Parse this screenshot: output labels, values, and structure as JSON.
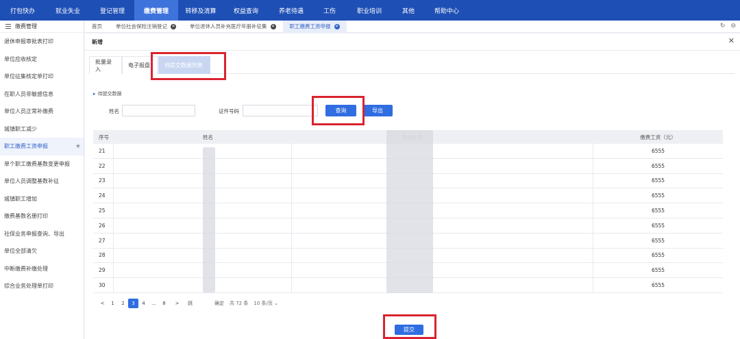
{
  "nav": {
    "items": [
      {
        "label": "打包快办"
      },
      {
        "label": "就业失业"
      },
      {
        "label": "登记管理"
      },
      {
        "label": "缴费管理",
        "active": true
      },
      {
        "label": "转移及清算"
      },
      {
        "label": "权益查询"
      },
      {
        "label": "养老待遇"
      },
      {
        "label": "工伤"
      },
      {
        "label": "职业培训"
      },
      {
        "label": "其他"
      },
      {
        "label": "帮助中心"
      }
    ]
  },
  "sidebar": {
    "title": "缴费管理",
    "items": [
      {
        "label": "退休申报审批表打印"
      },
      {
        "label": "单位应收核定"
      },
      {
        "label": "单位征集核定单打印"
      },
      {
        "label": "在职人员非敏感信息"
      },
      {
        "label": "单位人员正常补缴费"
      },
      {
        "label": "城镇职工减少"
      },
      {
        "label": "职工缴费工资申报",
        "active": true
      },
      {
        "label": "单个职工缴费基数变更申报"
      },
      {
        "label": "单位人员调整基数补征"
      },
      {
        "label": "城镇职工增加"
      },
      {
        "label": "缴费基数名册打印"
      },
      {
        "label": "社保业务申报查询、导出"
      },
      {
        "label": "单位全部清欠"
      },
      {
        "label": "中断缴费补缴处理"
      },
      {
        "label": "综合业务处理单打印"
      }
    ]
  },
  "tabs": {
    "items": [
      {
        "label": "首页",
        "closable": false
      },
      {
        "label": "单位社会保险注销登记",
        "closable": true
      },
      {
        "label": "单位退休人员补充医疗年册补征集",
        "closable": true
      },
      {
        "label": "职工缴费工资申报",
        "closable": true,
        "active": true
      }
    ]
  },
  "panel": {
    "title": "新增",
    "subtabs": [
      {
        "label": "批量录入"
      },
      {
        "label": "电子报盘"
      },
      {
        "label": "待提交数据列表",
        "active": true
      }
    ],
    "section_label": "待提交数据",
    "name_label": "姓名",
    "name_value": "",
    "id_label": "证件号码",
    "id_value": "",
    "query_button": "查询",
    "export_button": "导出",
    "submit_button": "提交"
  },
  "table": {
    "columns": [
      "序号",
      "姓名",
      "身份证号",
      "缴费工资（元）"
    ],
    "rows": [
      {
        "no": "21",
        "wage": "6555"
      },
      {
        "no": "22",
        "wage": "6555"
      },
      {
        "no": "23",
        "wage": "6555"
      },
      {
        "no": "24",
        "wage": "6555"
      },
      {
        "no": "25",
        "wage": "6555"
      },
      {
        "no": "26",
        "wage": "6555"
      },
      {
        "no": "27",
        "wage": "6555"
      },
      {
        "no": "28",
        "wage": "6555"
      },
      {
        "no": "29",
        "wage": "6555"
      },
      {
        "no": "30",
        "wage": "6555"
      }
    ]
  },
  "pager": {
    "prev": "<",
    "pages": [
      "1",
      "2",
      "3",
      "4",
      "...",
      "8"
    ],
    "current": "3",
    "next": ">",
    "goto_label": "跳",
    "confirm_label": "确定",
    "total": "共 72 条",
    "page_size": "10 条/页"
  },
  "colors": {
    "nav_bg": "#1e4fb5",
    "nav_active": "#3f73dc",
    "primary_button": "#2f6de1",
    "highlight_box": "#d9232e"
  }
}
